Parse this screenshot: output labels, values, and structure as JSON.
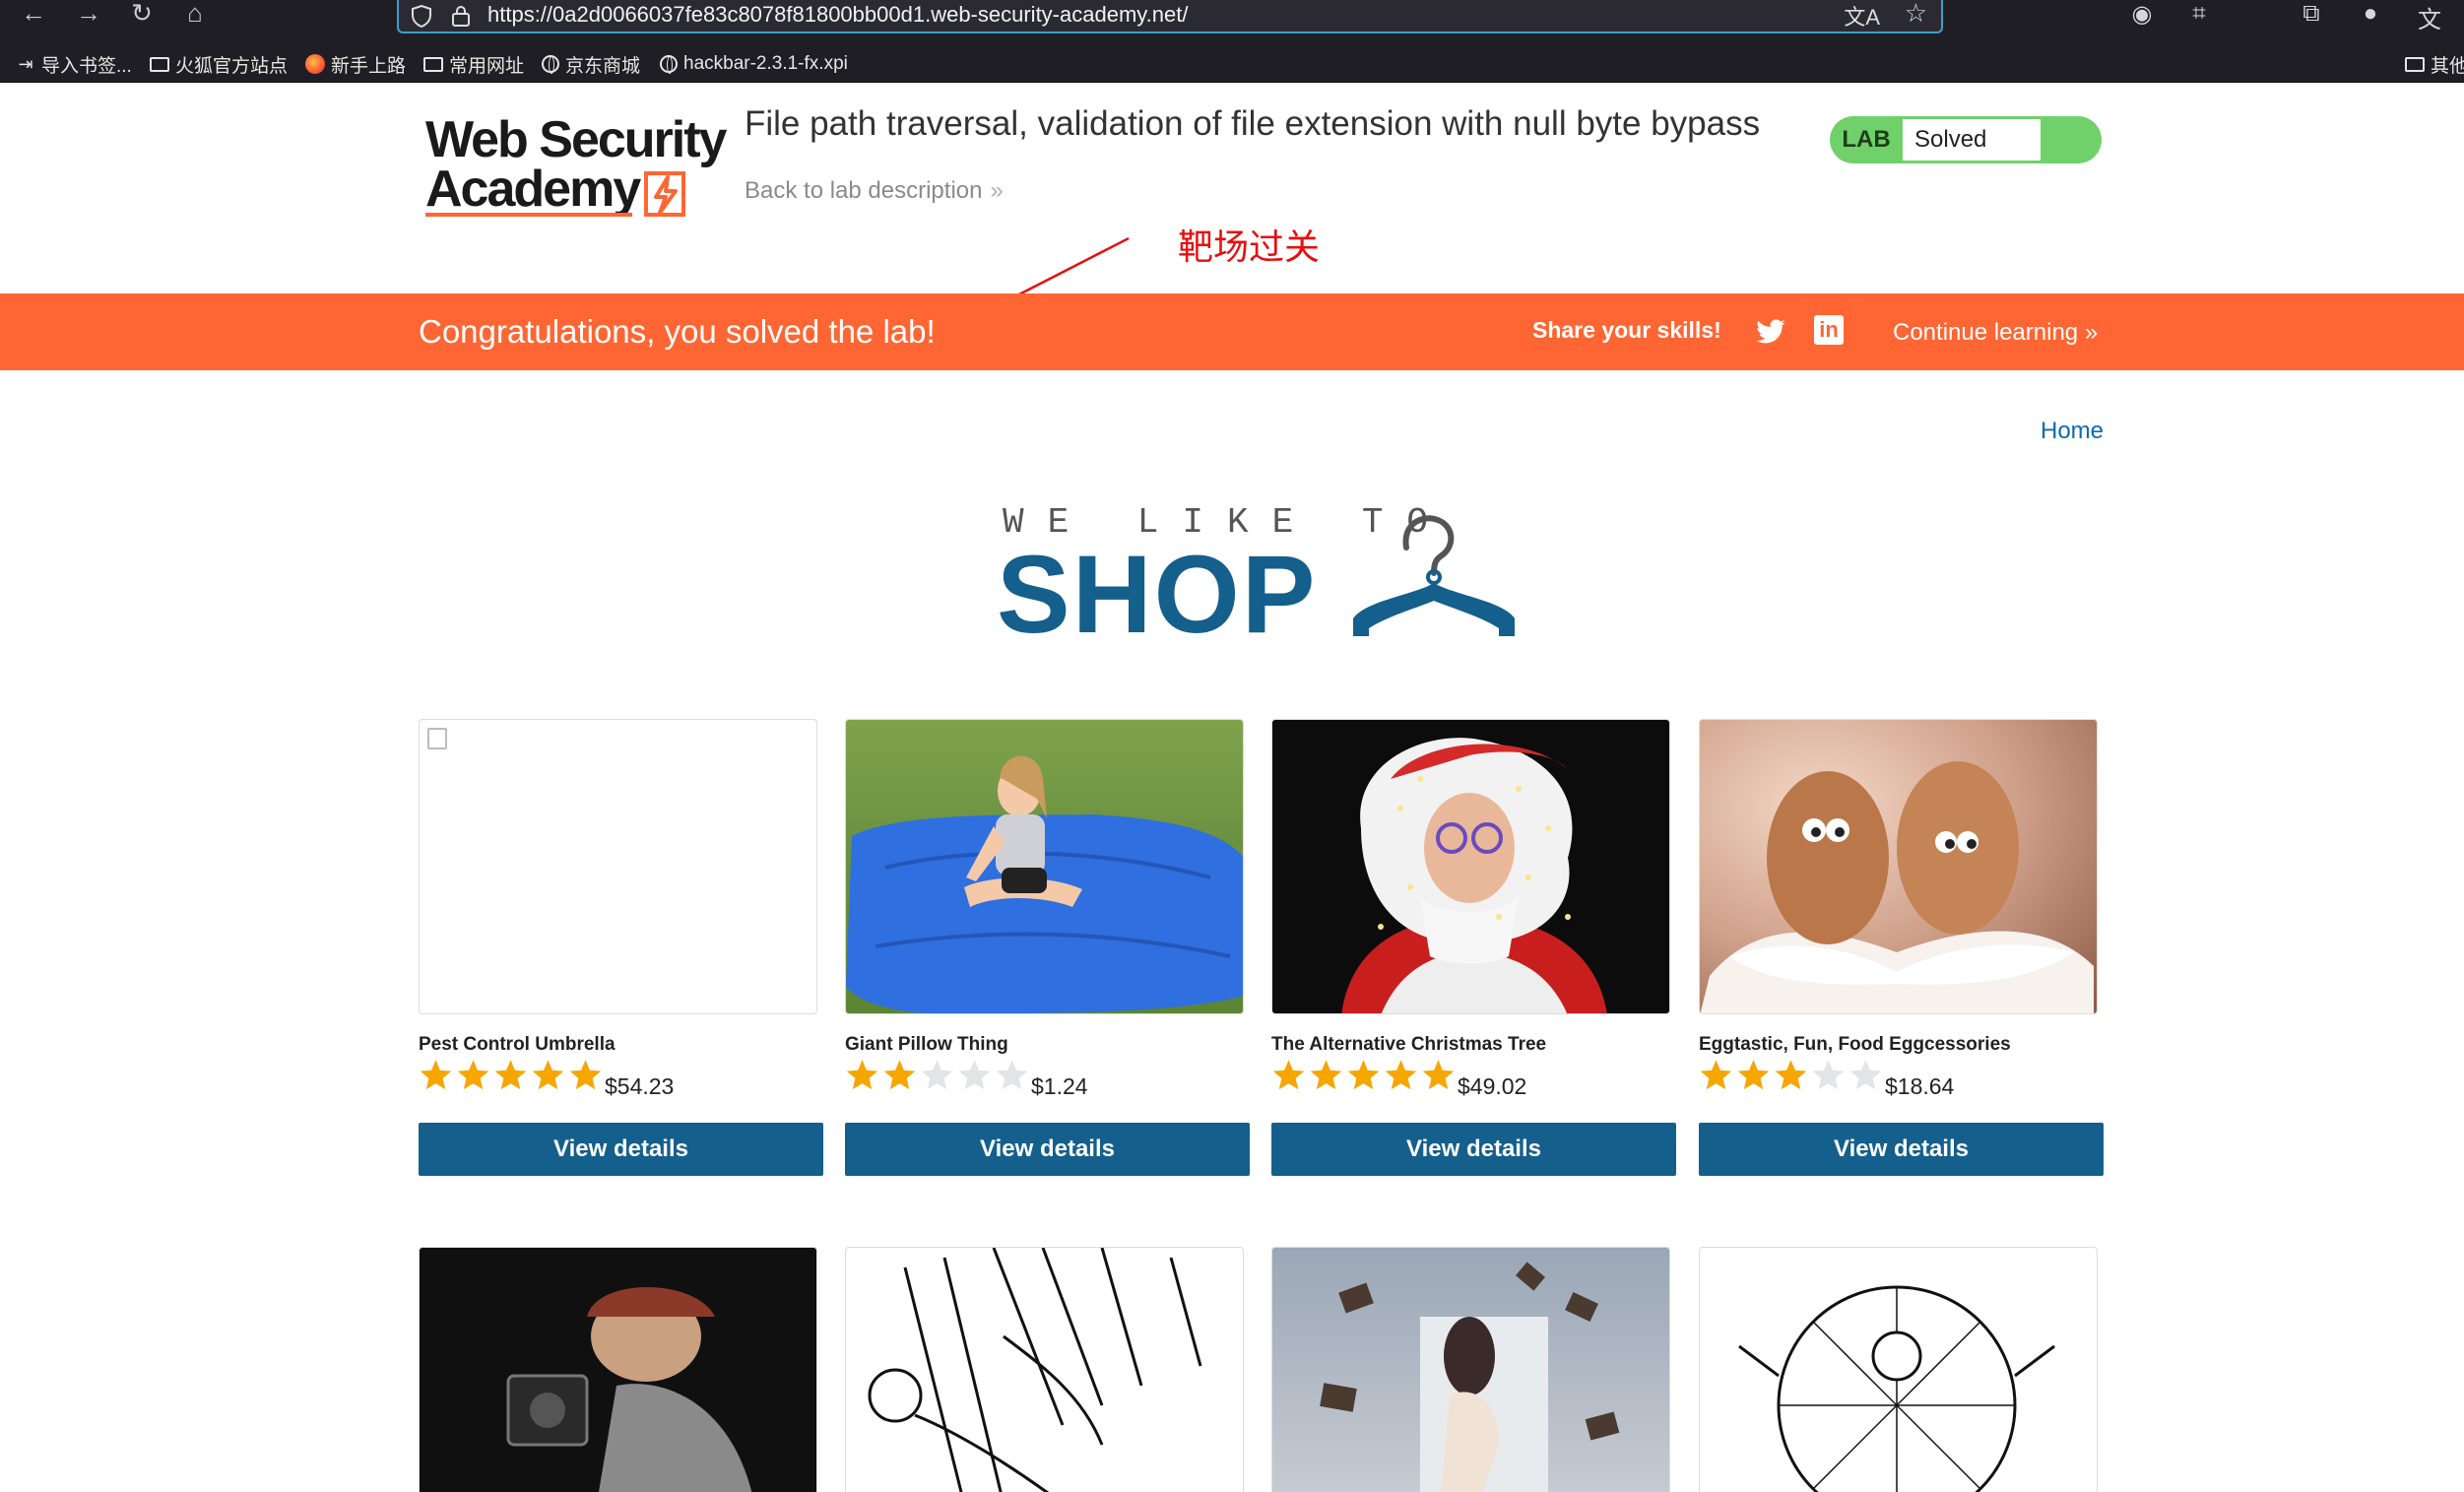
{
  "browser": {
    "url": "https://0a2d0066037fe83c8078f81800bb00d1.web-security-academy.net/",
    "bookmarks": [
      "导入书签...",
      "火狐官方站点",
      "新手上路",
      "常用网址",
      "京东商城",
      "hackbar-2.3.1-fx.xpi",
      "其他"
    ]
  },
  "header": {
    "logo_line1": "Web Security",
    "logo_line2": "Academy",
    "lab_title": "File path traversal, validation of file extension with null byte bypass",
    "back_link": "Back to lab description",
    "badge_lab": "LAB",
    "badge_status": "Solved"
  },
  "annotation": {
    "text": "靶场过关",
    "color": "#e60f0f"
  },
  "banner": {
    "congrats": "Congratulations, you solved the lab!",
    "share": "Share your skills!",
    "continue": "Continue learning",
    "color": "#ff6633"
  },
  "shop": {
    "home": "Home",
    "tagline": "WE LIKE TO",
    "title": "SHOP",
    "accent": "#145f8c",
    "view_details": "View details",
    "products": [
      {
        "name": "Pest Control Umbrella",
        "rating": 5,
        "price": "$54.23"
      },
      {
        "name": "Giant Pillow Thing",
        "rating": 2,
        "price": "$1.24"
      },
      {
        "name": "The Alternative Christmas Tree",
        "rating": 5,
        "price": "$49.02"
      },
      {
        "name": "Egg­tastic, Fun, Food Eggcessories",
        "rating": 3,
        "price": "$18.64"
      }
    ]
  }
}
